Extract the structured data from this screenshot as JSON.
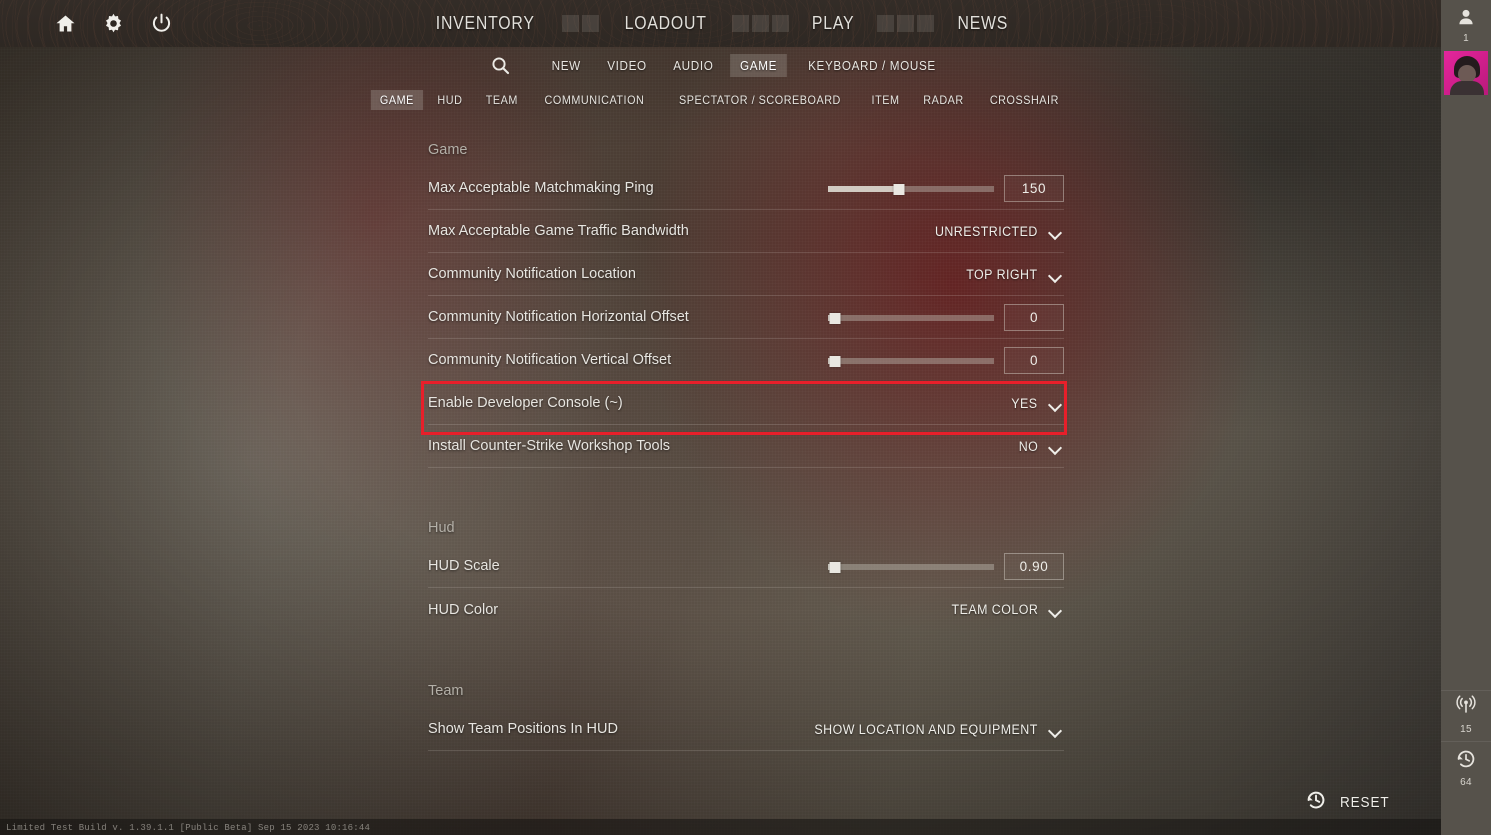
{
  "topbar": {
    "icons": [
      {
        "name": "home-icon",
        "label": "Home"
      },
      {
        "name": "settings-gear-icon",
        "label": "Settings"
      },
      {
        "name": "power-icon",
        "label": "Quit"
      }
    ],
    "nav": [
      {
        "label": "INVENTORY"
      },
      {
        "label": "LOADOUT"
      },
      {
        "label": "PLAY"
      },
      {
        "label": "NEWS"
      }
    ]
  },
  "settings_tabs": {
    "search_label": "search-icon",
    "items": [
      {
        "label": "NEW",
        "active": false
      },
      {
        "label": "VIDEO",
        "active": false
      },
      {
        "label": "AUDIO",
        "active": false
      },
      {
        "label": "GAME",
        "active": true
      },
      {
        "label": "KEYBOARD / MOUSE",
        "active": false
      }
    ]
  },
  "sub_tabs": {
    "items": [
      {
        "label": "GAME",
        "active": true
      },
      {
        "label": "HUD",
        "active": false
      },
      {
        "label": "TEAM",
        "active": false
      },
      {
        "label": "COMMUNICATION",
        "active": false
      },
      {
        "label": "SPECTATOR / SCOREBOARD",
        "active": false
      },
      {
        "label": "ITEM",
        "active": false
      },
      {
        "label": "RADAR",
        "active": false
      },
      {
        "label": "CROSSHAIR",
        "active": false
      }
    ]
  },
  "sections": [
    {
      "title": "Game",
      "rows": [
        {
          "label": "Max Acceptable Matchmaking Ping",
          "type": "slider",
          "value": "150",
          "fill_percent": 43
        },
        {
          "label": "Max Acceptable Game Traffic Bandwidth",
          "type": "dropdown",
          "value": "UNRESTRICTED"
        },
        {
          "label": "Community Notification Location",
          "type": "dropdown",
          "value": "TOP RIGHT"
        },
        {
          "label": "Community Notification Horizontal Offset",
          "type": "slider",
          "value": "0",
          "fill_percent": 3
        },
        {
          "label": "Community Notification Vertical Offset",
          "type": "slider",
          "value": "0",
          "fill_percent": 3
        },
        {
          "label": "Enable Developer Console (~)",
          "type": "dropdown",
          "value": "YES",
          "highlighted": true
        },
        {
          "label": "Install Counter-Strike Workshop Tools",
          "type": "dropdown",
          "value": "NO"
        }
      ]
    },
    {
      "title": "Hud",
      "rows": [
        {
          "label": "HUD Scale",
          "type": "slider",
          "value": "0.90",
          "fill_percent": 3
        },
        {
          "label": "HUD Color",
          "type": "dropdown",
          "value": "TEAM COLOR"
        }
      ]
    },
    {
      "title": "Team",
      "rows": [
        {
          "label": "Show Team Positions In HUD",
          "type": "dropdown",
          "value": "SHOW LOCATION AND EQUIPMENT"
        }
      ]
    }
  ],
  "reset": {
    "label": "RESET",
    "icon": "reset-clock-icon"
  },
  "rail": {
    "friends_icon": "person-icon",
    "friends_count": "1",
    "avatar": "player-avatar",
    "ping_icon": "signal-icon",
    "ping_value": "15",
    "tickrate_icon": "clock-icon",
    "tickrate_value": "64"
  },
  "build_string": "Limited Test Build v. 1.39.1.1 [Public Beta] Sep 15 2023 10:16:44",
  "colors": {
    "highlight_red": "#e81f2a",
    "tab_active_bg": "rgba(190,186,178,.28)",
    "text_primary": "#e7e5e0",
    "rail_bg": "#56524b"
  }
}
